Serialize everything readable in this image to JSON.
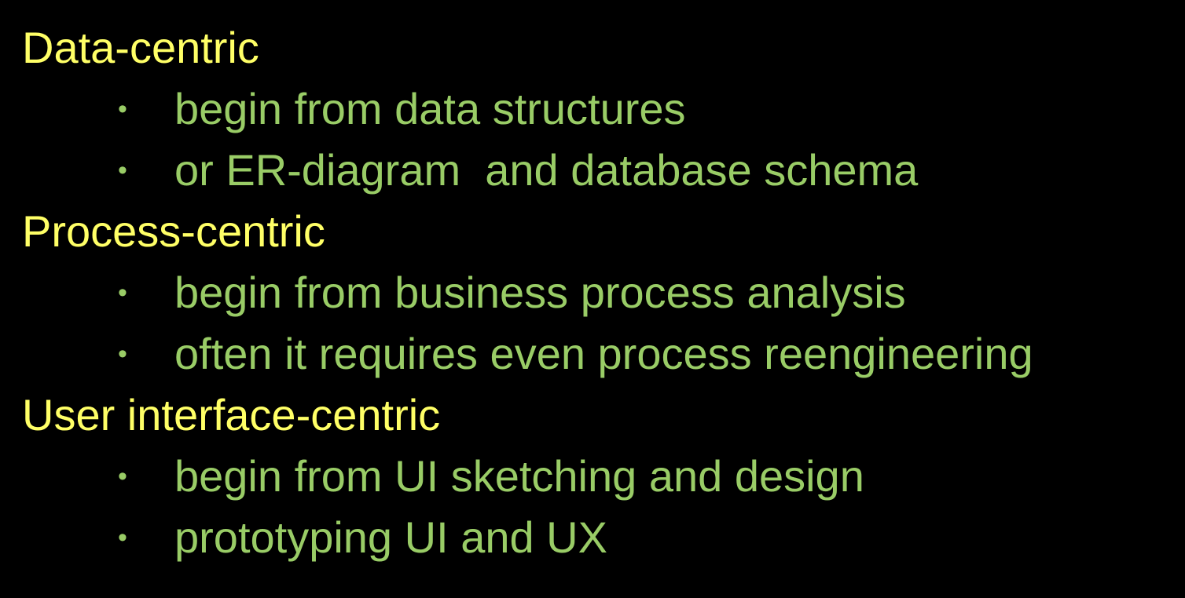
{
  "colors": {
    "background": "#000000",
    "heading": "#ffff66",
    "bullet_text": "#99cc66"
  },
  "sections": [
    {
      "title": "Data-centric",
      "bullets": [
        "begin from data structures",
        "or ER-diagram  and database schema"
      ]
    },
    {
      "title": "Process-centric",
      "bullets": [
        "begin from business process analysis",
        "often it requires even process reengineering"
      ]
    },
    {
      "title": "User interface-centric",
      "bullets": [
        "begin from UI sketching and design",
        "prototyping UI and UX"
      ]
    }
  ],
  "bullet_glyph": "•"
}
